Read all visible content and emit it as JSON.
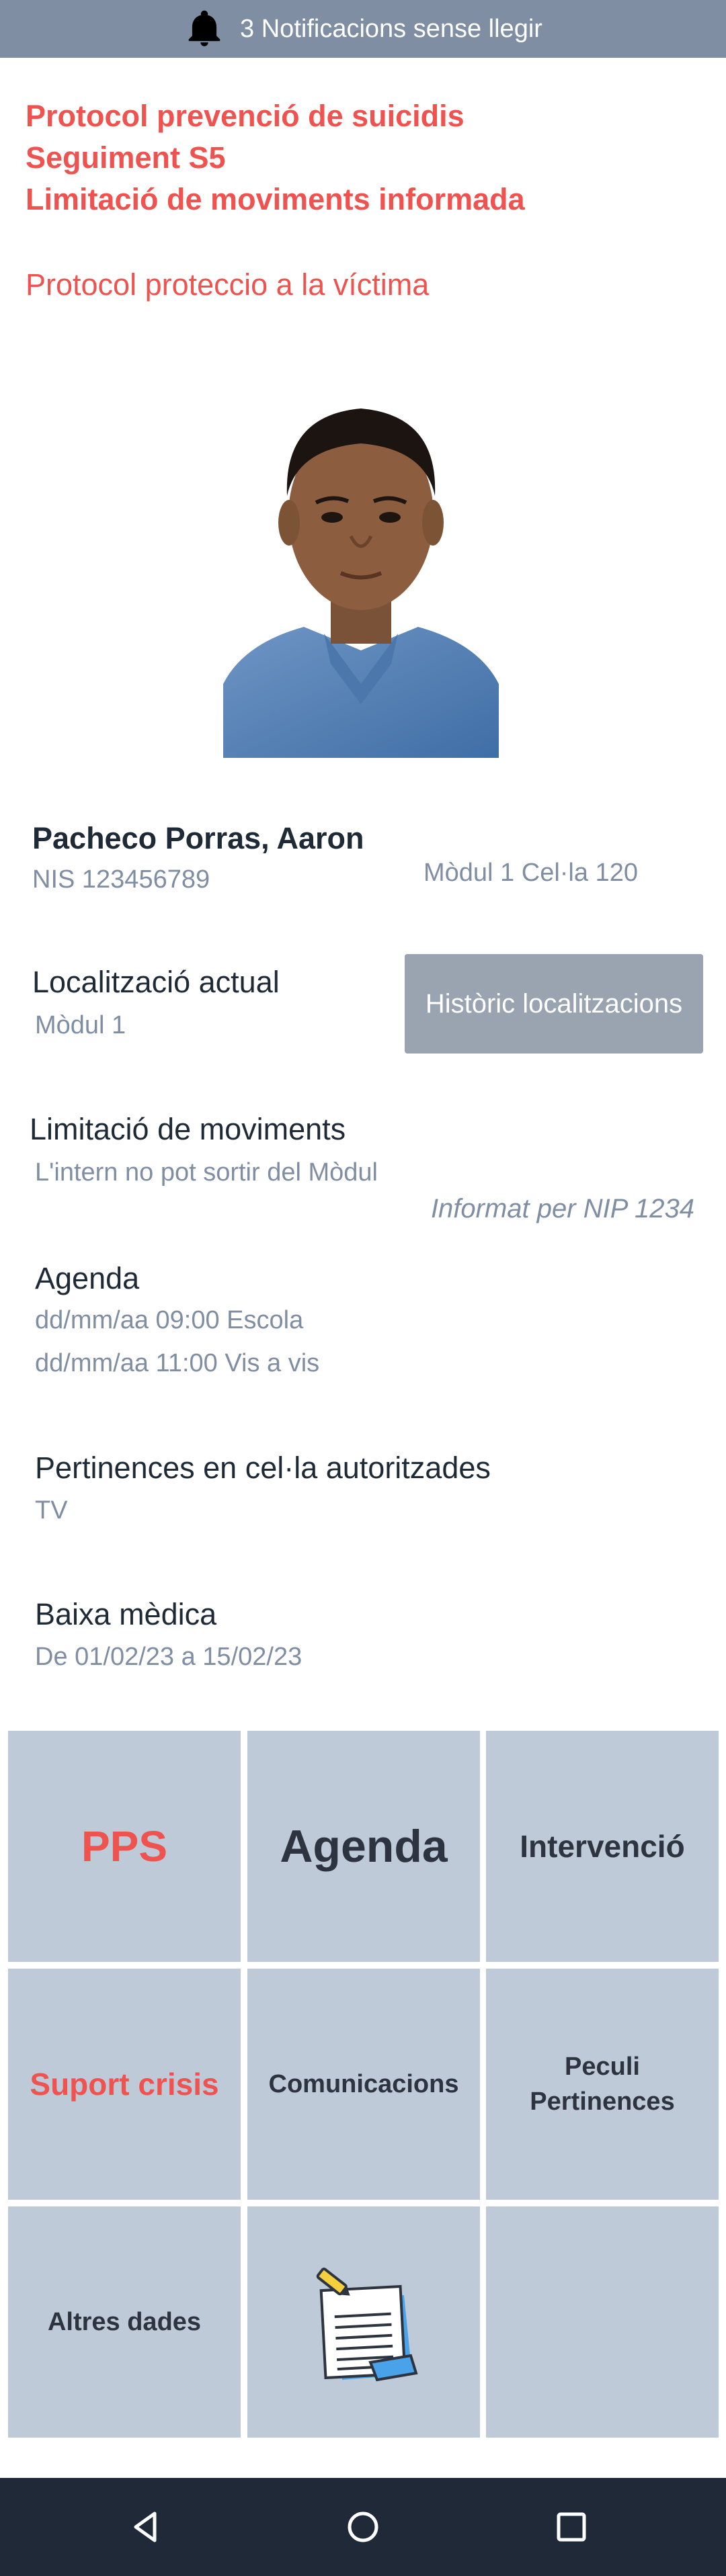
{
  "notification": {
    "text": "3 Notificacions sense llegir",
    "icon": "bell-icon"
  },
  "alerts": {
    "bold": [
      "Protocol prevenció de suicidis",
      "Seguiment S5",
      "Limitació de moviments informada"
    ],
    "regular": "Protocol proteccio a la víctima"
  },
  "profile": {
    "name": "Pacheco Porras, Aaron",
    "nis": "NIS 123456789",
    "cell": "Mòdul 1 Cel·la 120"
  },
  "location": {
    "title": "Localització actual",
    "value": "Mòdul 1",
    "history_button": "Històric localitzacions"
  },
  "movement": {
    "title": "Limitació de moviments",
    "value": "L'intern no pot sortir del Mòdul",
    "informed_by": "Informat per NIP 1234"
  },
  "agenda": {
    "title": "Agenda",
    "items": [
      "dd/mm/aa 09:00 Escola",
      "dd/mm/aa 11:00 Vis a vis"
    ]
  },
  "belongings": {
    "title": "Pertinences en cel·la autoritzades",
    "value": "TV"
  },
  "sick_leave": {
    "title": "Baixa mèdica",
    "value": "De 01/02/23 a 15/02/23"
  },
  "tiles": {
    "pps": "PPS",
    "agenda": "Agenda",
    "intervencio": "Intervenció",
    "suport_crisis": "Suport crisis",
    "comunicacions": "Comunicacions",
    "peculi_line1": "Peculi",
    "peculi_line2": "Pertinences",
    "altres_dades": "Altres dades",
    "notes_icon": "notepad-icon"
  },
  "colors": {
    "alert": "#ef5350",
    "tile": "#bfcad8",
    "header": "#7f8ea3",
    "navbar": "#1f2937"
  },
  "navigation": {
    "icons": [
      "back-icon",
      "home-icon",
      "recents-icon"
    ]
  }
}
